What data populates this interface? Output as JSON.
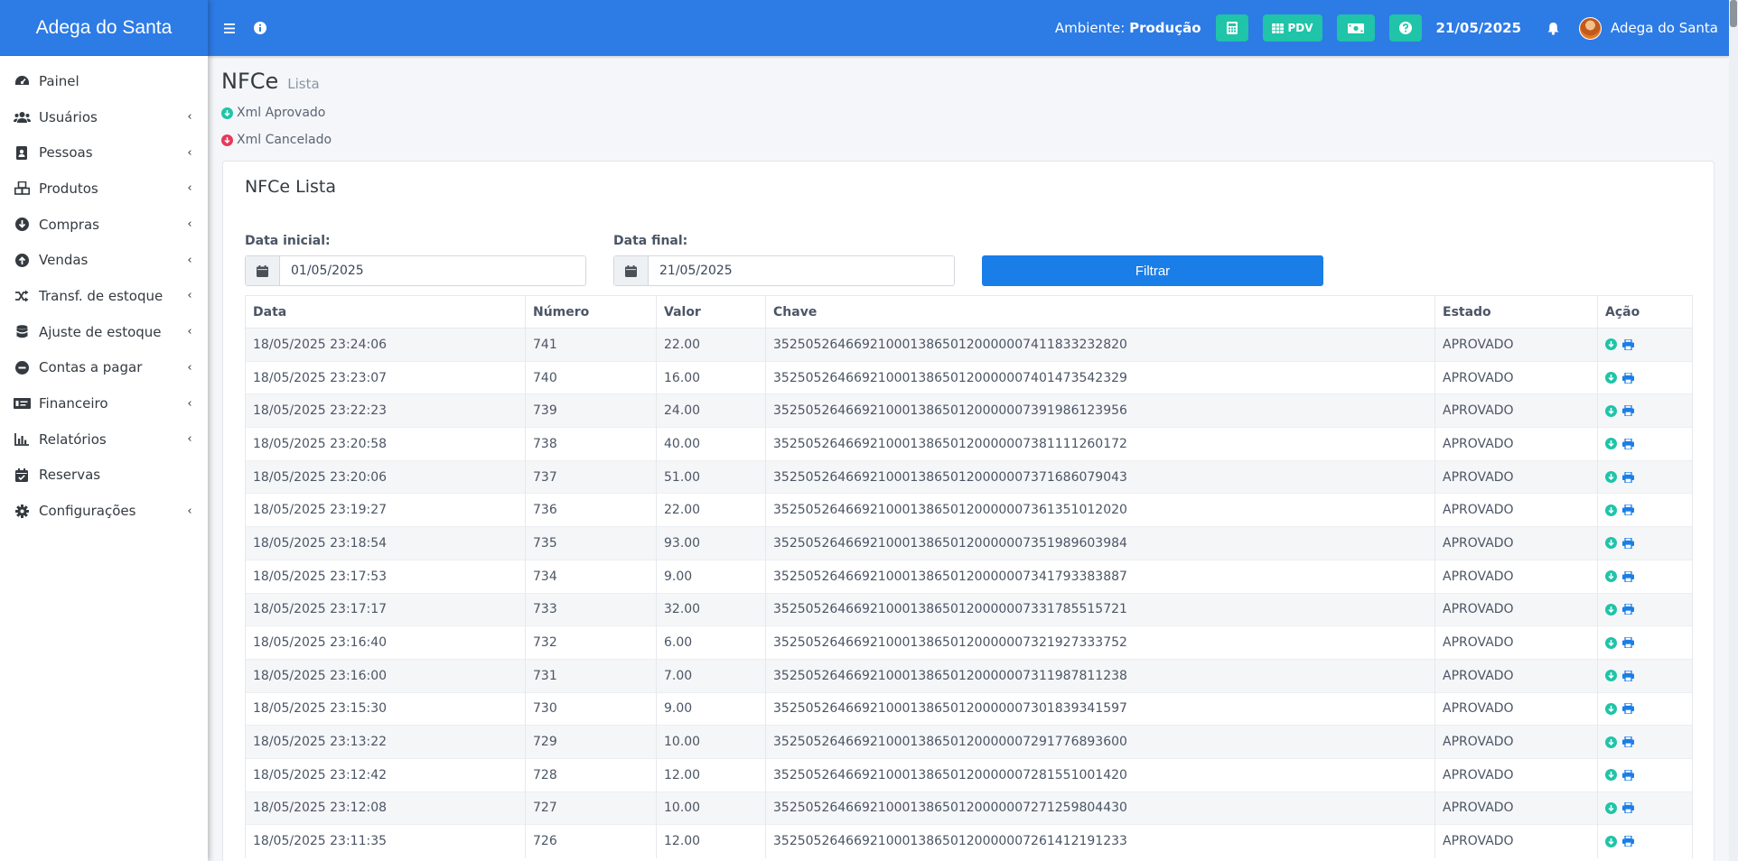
{
  "brand": "Adega do Santa",
  "sidebar": {
    "items": [
      {
        "label": "Painel",
        "icon": "tachometer-icon",
        "caret": ""
      },
      {
        "label": "Usuários",
        "icon": "users-icon",
        "caret": "‹"
      },
      {
        "label": "Pessoas",
        "icon": "address-book-icon",
        "caret": "‹"
      },
      {
        "label": "Produtos",
        "icon": "boxes-icon",
        "caret": "‹"
      },
      {
        "label": "Compras",
        "icon": "arrow-circle-down-icon",
        "caret": "‹"
      },
      {
        "label": "Vendas",
        "icon": "arrow-circle-up-icon",
        "caret": "‹"
      },
      {
        "label": "Transf. de estoque",
        "icon": "random-icon",
        "caret": "‹"
      },
      {
        "label": "Ajuste de estoque",
        "icon": "database-icon",
        "caret": "‹"
      },
      {
        "label": "Contas a pagar",
        "icon": "minus-circle-icon",
        "caret": "‹"
      },
      {
        "label": "Financeiro",
        "icon": "money-check-icon",
        "caret": "‹"
      },
      {
        "label": "Relatórios",
        "icon": "chart-bar-icon",
        "caret": "‹"
      },
      {
        "label": "Reservas",
        "icon": "calendar-check-icon",
        "caret": ""
      },
      {
        "label": "Configurações",
        "icon": "cog-icon",
        "caret": "‹"
      }
    ]
  },
  "topbar": {
    "env_label": "Ambiente:",
    "env_value": "Produção",
    "pdv_label": "PDV",
    "date": "21/05/2025",
    "user_name": "Adega do Santa"
  },
  "page": {
    "title": "NFCe",
    "subtitle": "Lista",
    "legend_approved": "Xml Aprovado",
    "legend_canceled": "Xml Cancelado"
  },
  "card": {
    "title": "NFCe Lista",
    "start_label": "Data inicial:",
    "start_value": "01/05/2025",
    "end_label": "Data final:",
    "end_value": "21/05/2025",
    "filter_label": "Filtrar"
  },
  "table": {
    "headers": [
      "Data",
      "Número",
      "Valor",
      "Chave",
      "Estado",
      "Ação"
    ],
    "rows": [
      [
        "18/05/2025 23:24:06",
        "741",
        "22.00",
        "35250526466921000138650120000007411833232820",
        "APROVADO"
      ],
      [
        "18/05/2025 23:23:07",
        "740",
        "16.00",
        "35250526466921000138650120000007401473542329",
        "APROVADO"
      ],
      [
        "18/05/2025 23:22:23",
        "739",
        "24.00",
        "35250526466921000138650120000007391986123956",
        "APROVADO"
      ],
      [
        "18/05/2025 23:20:58",
        "738",
        "40.00",
        "35250526466921000138650120000007381111260172",
        "APROVADO"
      ],
      [
        "18/05/2025 23:20:06",
        "737",
        "51.00",
        "35250526466921000138650120000007371686079043",
        "APROVADO"
      ],
      [
        "18/05/2025 23:19:27",
        "736",
        "22.00",
        "35250526466921000138650120000007361351012020",
        "APROVADO"
      ],
      [
        "18/05/2025 23:18:54",
        "735",
        "93.00",
        "35250526466921000138650120000007351989603984",
        "APROVADO"
      ],
      [
        "18/05/2025 23:17:53",
        "734",
        "9.00",
        "35250526466921000138650120000007341793383887",
        "APROVADO"
      ],
      [
        "18/05/2025 23:17:17",
        "733",
        "32.00",
        "35250526466921000138650120000007331785515721",
        "APROVADO"
      ],
      [
        "18/05/2025 23:16:40",
        "732",
        "6.00",
        "35250526466921000138650120000007321927333752",
        "APROVADO"
      ],
      [
        "18/05/2025 23:16:00",
        "731",
        "7.00",
        "35250526466921000138650120000007311987811238",
        "APROVADO"
      ],
      [
        "18/05/2025 23:15:30",
        "730",
        "9.00",
        "35250526466921000138650120000007301839341597",
        "APROVADO"
      ],
      [
        "18/05/2025 23:13:22",
        "729",
        "10.00",
        "35250526466921000138650120000007291776893600",
        "APROVADO"
      ],
      [
        "18/05/2025 23:12:42",
        "728",
        "12.00",
        "35250526466921000138650120000007281551001420",
        "APROVADO"
      ],
      [
        "18/05/2025 23:12:08",
        "727",
        "10.00",
        "35250526466921000138650120000007271259804430",
        "APROVADO"
      ],
      [
        "18/05/2025 23:11:35",
        "726",
        "12.00",
        "35250526466921000138650120000007261412191233",
        "APROVADO"
      ]
    ]
  },
  "colors": {
    "primary": "#2d7be5",
    "accent": "#20c4a8",
    "danger": "#e6395a",
    "button": "#1a7ee8"
  }
}
